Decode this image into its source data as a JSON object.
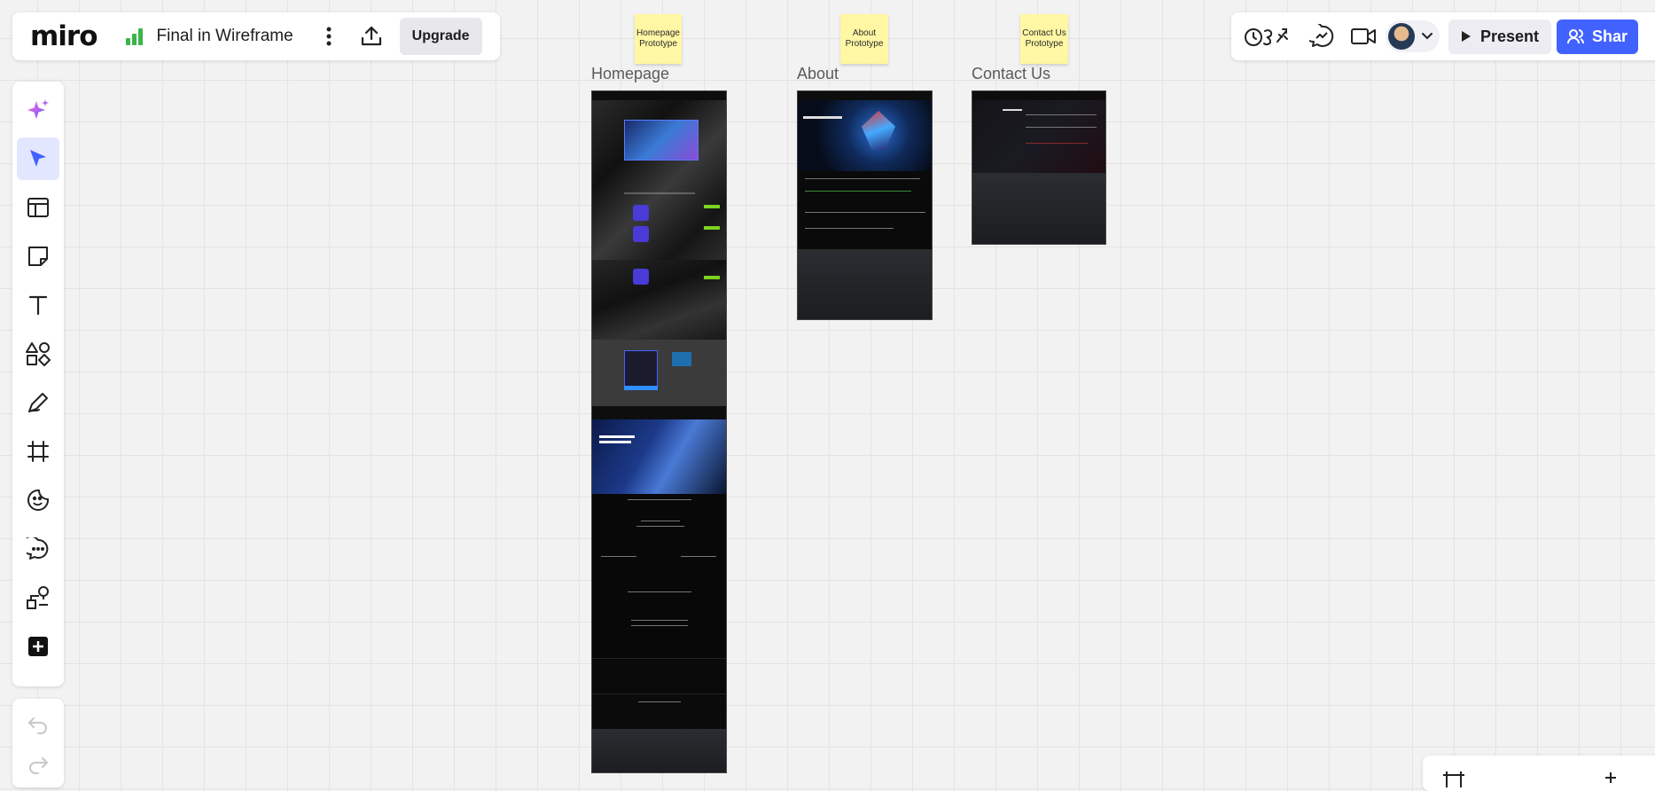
{
  "app": {
    "logo": "miro",
    "board_title": "Final in Wireframe",
    "upgrade_label": "Upgrade"
  },
  "header_right": {
    "present_label": "Present",
    "share_label": "Shar"
  },
  "icons": {
    "top_left": [
      "board-stats-icon",
      "more-vertical-icon",
      "upload-icon"
    ],
    "top_right": [
      "timer-reactions-icon",
      "chat-icon",
      "video-icon",
      "avatar",
      "chevron-down-icon",
      "play-icon",
      "users-icon"
    ],
    "toolbar": [
      "sparkle-ai-icon",
      "select-pointer-icon",
      "templates-icon",
      "sticky-note-icon",
      "text-icon",
      "shapes-icon",
      "pen-icon",
      "frame-icon",
      "sticker-icon",
      "comment-icon",
      "diagram-icon",
      "add-more-icon"
    ],
    "undo_redo": [
      "undo-icon",
      "redo-icon"
    ]
  },
  "canvas": {
    "sticky_notes": [
      {
        "text": "Homepage Prototype"
      },
      {
        "text": "About Prototype"
      },
      {
        "text": "Contact Us Prototype"
      }
    ],
    "frames": [
      {
        "label": "Homepage"
      },
      {
        "label": "About"
      },
      {
        "label": "Contact Us"
      }
    ]
  },
  "colors": {
    "accent": "#4262ff",
    "sticky": "#fff7a3",
    "canvas_bg": "#f2f2f2",
    "stats_green": "#3bb54a"
  }
}
